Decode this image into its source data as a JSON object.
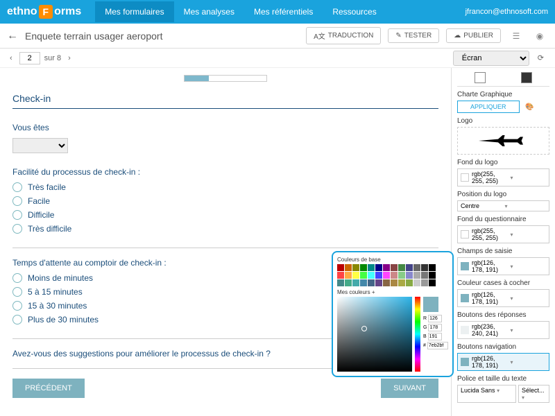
{
  "topbar": {
    "logo_text1": "ethno",
    "logo_text2": "F",
    "logo_text3": "orms",
    "tabs": [
      "Mes formulaires",
      "Mes analyses",
      "Mes référentiels",
      "Ressources"
    ],
    "user_email": "jfrancon@ethnosoft.com"
  },
  "toolbar": {
    "title": "Enquete terrain usager aeroport",
    "btn_traduction": "TRADUCTION",
    "btn_tester": "TESTER",
    "btn_publier": "PUBLIER"
  },
  "pager": {
    "current": "2",
    "total_label": "sur 8",
    "screen_label": "Écran"
  },
  "preview": {
    "section_title": "Check-in",
    "q1_label": "Vous êtes",
    "q2_label": "Facilité du processus de check-in :",
    "q2_options": [
      "Très facile",
      "Facile",
      "Difficile",
      "Très difficile"
    ],
    "q3_label": "Temps d'attente au comptoir de check-in :",
    "q3_options": [
      "Moins de minutes",
      "5 à 15 minutes",
      "15 à 30 minutes",
      "Plus de 30 minutes"
    ],
    "q4_label": "Avez-vous des suggestions pour améliorer le processus de check-in ?",
    "btn_prev": "PRÉCÉDENT",
    "btn_next": "SUIVANT"
  },
  "sidebar": {
    "charte_label": "Charte Graphique",
    "apply": "APPLIQUER",
    "logo_label": "Logo",
    "fields": {
      "fond_logo": {
        "label": "Fond du logo",
        "value": "rgb(255, 255, 255)",
        "color": "#ffffff"
      },
      "position_logo": {
        "label": "Position du logo",
        "value": "Centre"
      },
      "fond_quest": {
        "label": "Fond du questionnaire",
        "value": "rgb(255, 255, 255)",
        "color": "#ffffff"
      },
      "champs": {
        "label": "Champs de saisie",
        "value": "rgb(126, 178, 191)",
        "color": "#7eb2bf"
      },
      "cases": {
        "label": "Couleur cases à cocher",
        "value": "rgb(126, 178, 191)",
        "color": "#7eb2bf"
      },
      "boutons_rep": {
        "label": "Boutons des réponses",
        "value": "rgb(236, 240, 241)",
        "color": "#ecf0f1"
      },
      "boutons_nav": {
        "label": "Boutons navigation",
        "value": "rgb(126, 178, 191)",
        "color": "#7eb2bf"
      },
      "police": {
        "label": "Police et taille du texte",
        "font": "Lucida Sans",
        "size": "Sélect..."
      }
    }
  },
  "picker": {
    "base_label": "Couleurs de base",
    "my_label": "Mes couleurs",
    "r": "126",
    "g": "178",
    "b": "191",
    "hex": "7eb2bf",
    "r_lbl": "R",
    "g_lbl": "G",
    "b_lbl": "B"
  }
}
